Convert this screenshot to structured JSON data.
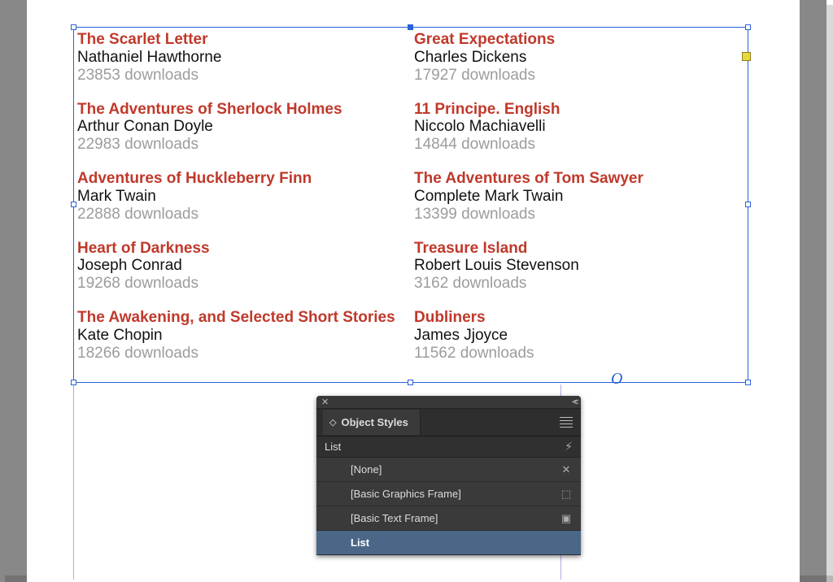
{
  "colors": {
    "title": "#c0392b",
    "author": "#111111",
    "downloads": "#9c9c9c"
  },
  "books_left": [
    {
      "title": "The Scarlet Letter",
      "author": "Nathaniel Hawthorne",
      "downloads": "23853 downloads"
    },
    {
      "title": "The Adventures of Sherlock Holmes",
      "author": "Arthur Conan Doyle",
      "downloads": "22983 downloads"
    },
    {
      "title": "Adventures of Huckleberry Finn",
      "author": "Mark Twain",
      "downloads": "22888 downloads"
    },
    {
      "title": "Heart of Darkness",
      "author": "Joseph Conrad",
      "downloads": "19268 downloads"
    },
    {
      "title": "The Awakening, and Selected Short Stories",
      "author": "Kate Chopin",
      "downloads": "18266 downloads"
    }
  ],
  "books_right": [
    {
      "title": "Great Expectations",
      "author": "Charles Dickens",
      "downloads": "17927 downloads"
    },
    {
      "title": "11 Principe. English",
      "author": "Niccolo Machiavelli",
      "downloads": "14844 downloads"
    },
    {
      "title": "The Adventures of Tom Sawyer",
      "author": "Complete Mark Twain",
      "downloads": "13399 downloads"
    },
    {
      "title": "Treasure Island",
      "author": "Robert Louis Stevenson",
      "downloads": "3162 downloads"
    },
    {
      "title": "Dubliners",
      "author": "James Jjoyce",
      "downloads": "11562 downloads"
    }
  ],
  "overset_glyph": "O",
  "panel": {
    "tab_label": "Object Styles",
    "filter_label": "List",
    "rows": [
      {
        "label": "[None]",
        "icon": "✕"
      },
      {
        "label": "[Basic Graphics Frame]",
        "icon": "⬚"
      },
      {
        "label": "[Basic Text Frame]",
        "icon": "▣"
      },
      {
        "label": "List",
        "icon": ""
      }
    ],
    "selected_index": 3
  }
}
